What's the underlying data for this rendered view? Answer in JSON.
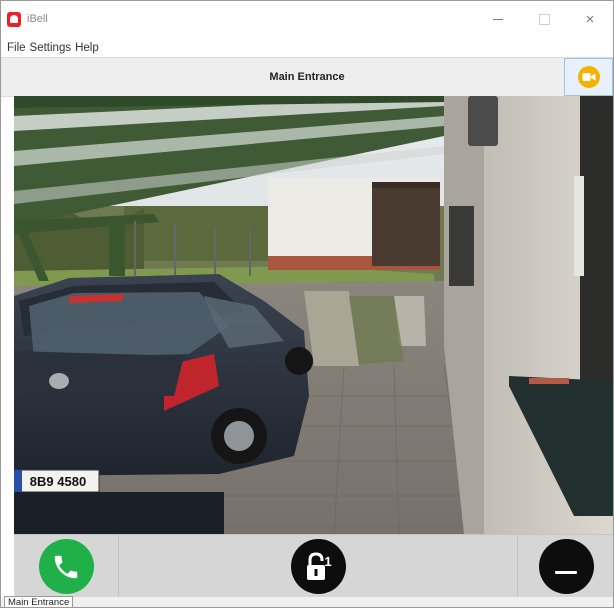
{
  "window": {
    "title": "iBell",
    "icon": "bell-icon",
    "controls": {
      "minimize": "minimize-icon",
      "maximize": "maximize-icon",
      "close": "×"
    }
  },
  "menu": {
    "items": [
      {
        "label": "File"
      },
      {
        "label": "Settings"
      },
      {
        "label": "Help"
      }
    ]
  },
  "header": {
    "title": "Main Entrance",
    "camera_icon": "video-camera-icon",
    "camera_color": "#f5b100"
  },
  "video": {
    "plate_text": "8B9 4580"
  },
  "controls": {
    "accept_icon": "phone-icon",
    "accept_color": "#20b04a",
    "unlock_icon": "padlock-icon",
    "unlock_number": "1",
    "hangup_icon": "hang-up-icon"
  },
  "status": {
    "tab_label": "Main Entrance"
  }
}
